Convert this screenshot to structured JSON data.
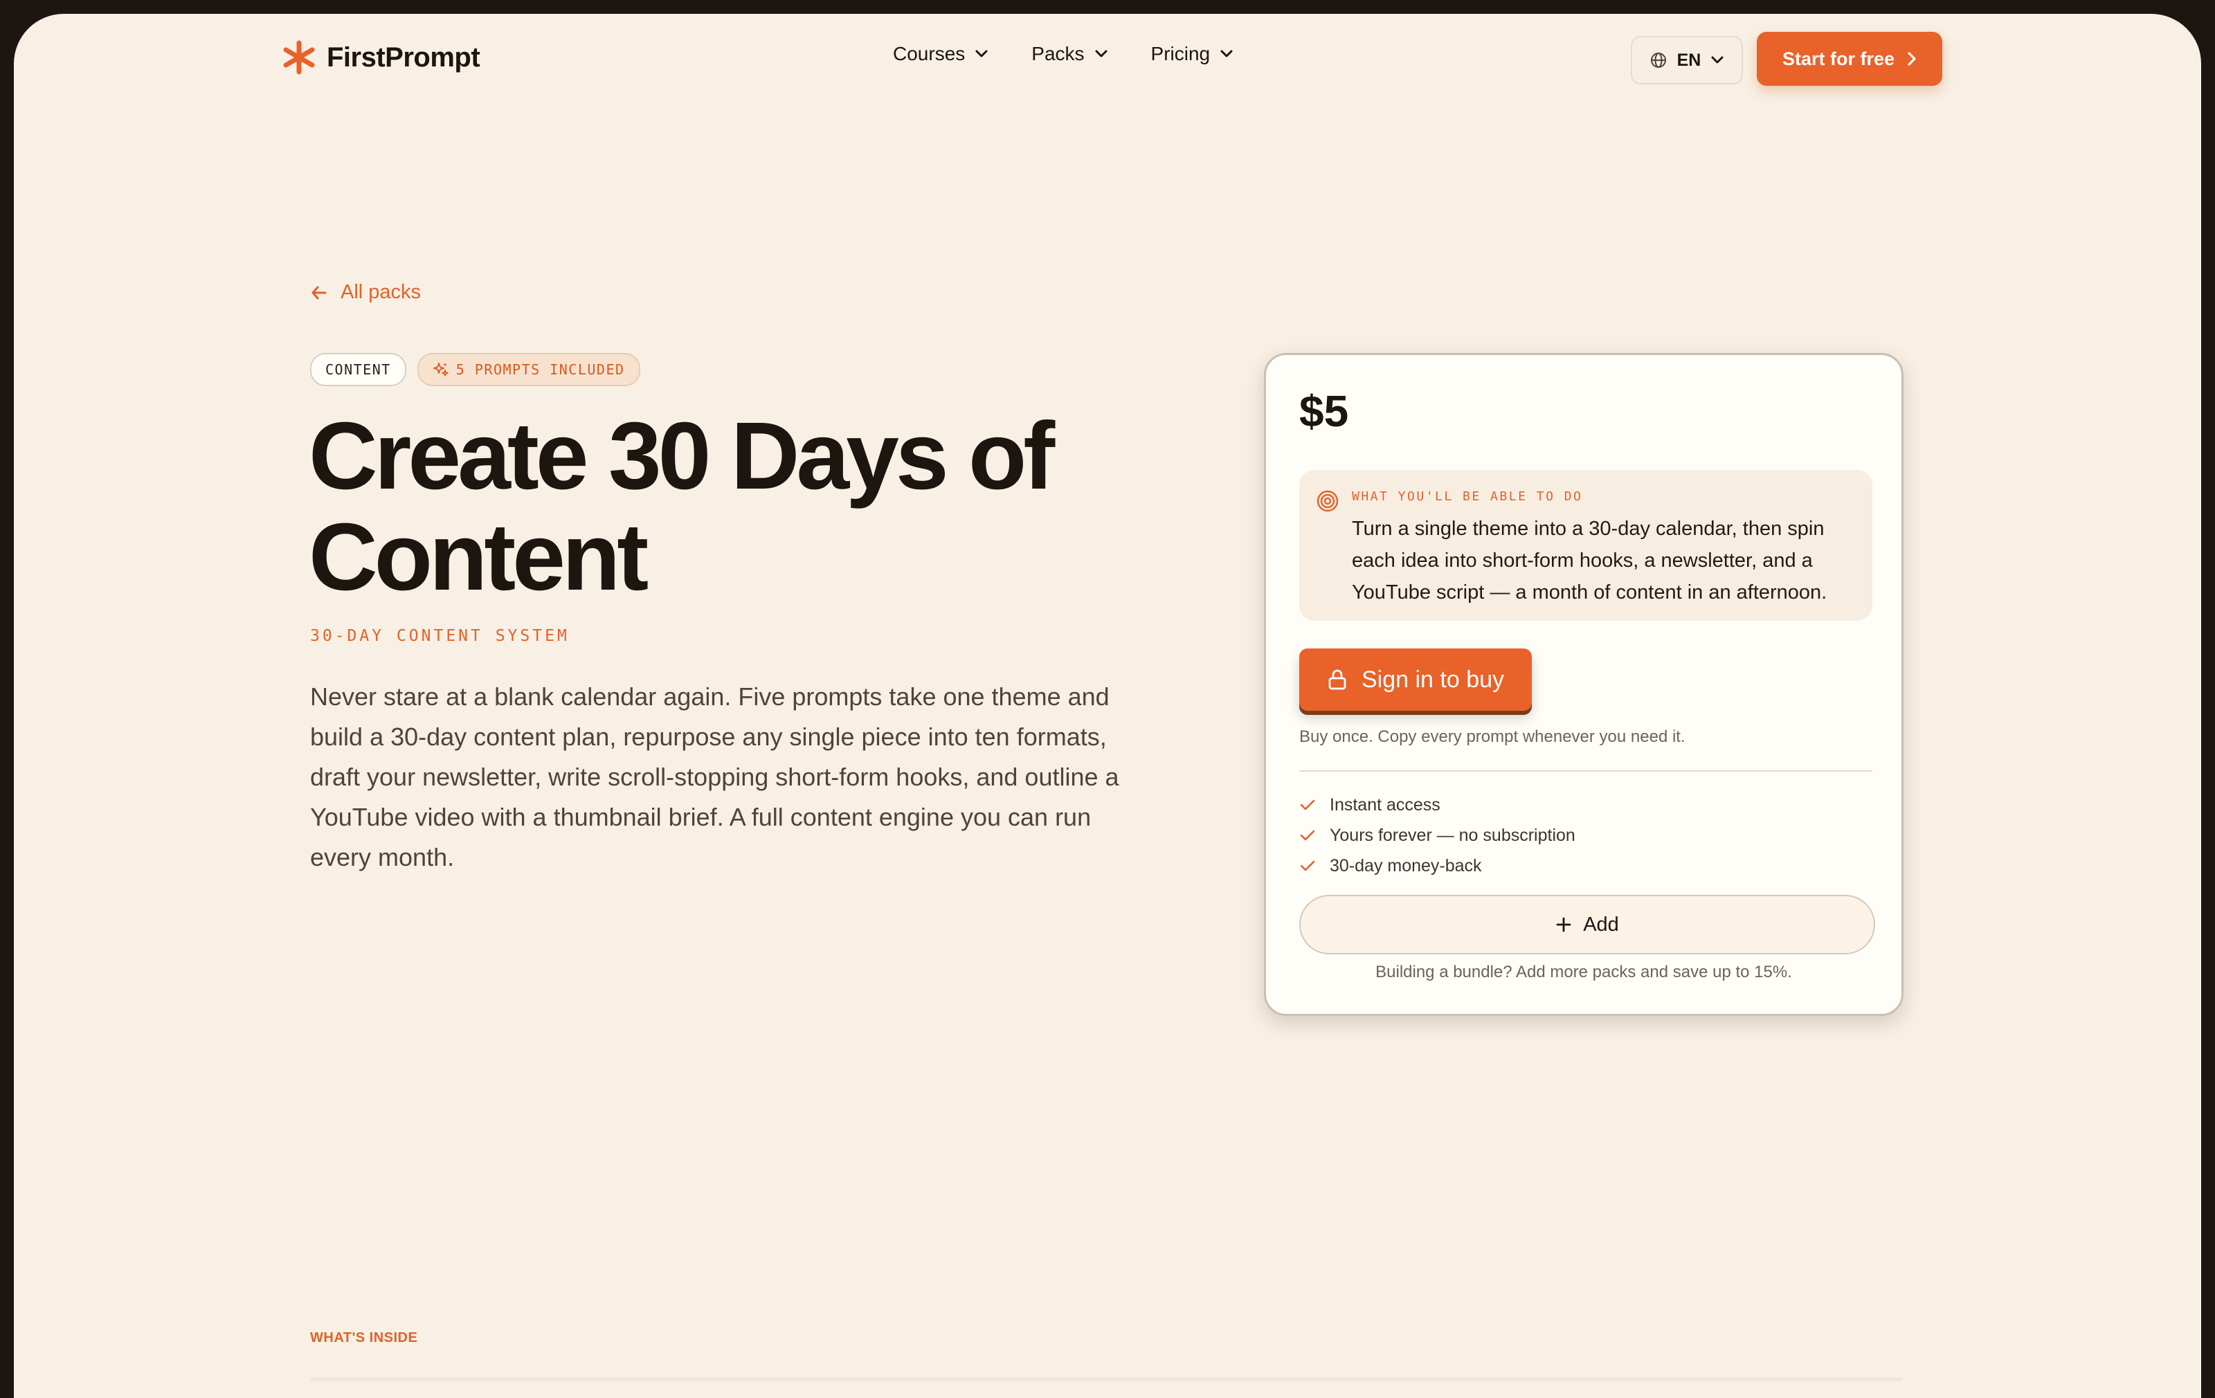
{
  "header": {
    "brand": "FirstPrompt",
    "nav": [
      {
        "label": "Courses"
      },
      {
        "label": "Packs"
      },
      {
        "label": "Pricing"
      }
    ],
    "language": "EN",
    "cta_label": "Start for free"
  },
  "back_link": "All packs",
  "tags": {
    "category": "CONTENT",
    "prompts_included": "5 PROMPTS INCLUDED"
  },
  "hero": {
    "title": "Create 30 Days of Content",
    "kicker": "30-DAY CONTENT SYSTEM",
    "description": "Never stare at a blank calendar again. Five prompts take one theme and build a 30-day content plan, repurpose any single piece into ten formats, draft your newsletter, write scroll-stopping short-form hooks, and outline a YouTube video with a thumbnail brief. A full content engine you can run every month."
  },
  "purchase_card": {
    "price": "$5",
    "outcome_label": "WHAT YOU'LL BE ABLE TO DO",
    "outcome_text": "Turn a single theme into a 30-day calendar, then spin each idea into short-form hooks, a newsletter, and a YouTube script — a month of content in an afternoon.",
    "buy_button": "Sign in to buy",
    "buy_note": "Buy once. Copy every prompt whenever you need it.",
    "benefits": [
      "Instant access",
      "Yours forever — no subscription",
      "30-day money-back"
    ],
    "add_button": "Add",
    "bundle_note": "Building a bundle? Add more packs and save up to 15%."
  },
  "section_label": "WHAT'S INSIDE",
  "colors": {
    "accent": "#e8622a",
    "background": "#f8f0e4",
    "card": "#fffdf8",
    "text": "#1c1510"
  }
}
